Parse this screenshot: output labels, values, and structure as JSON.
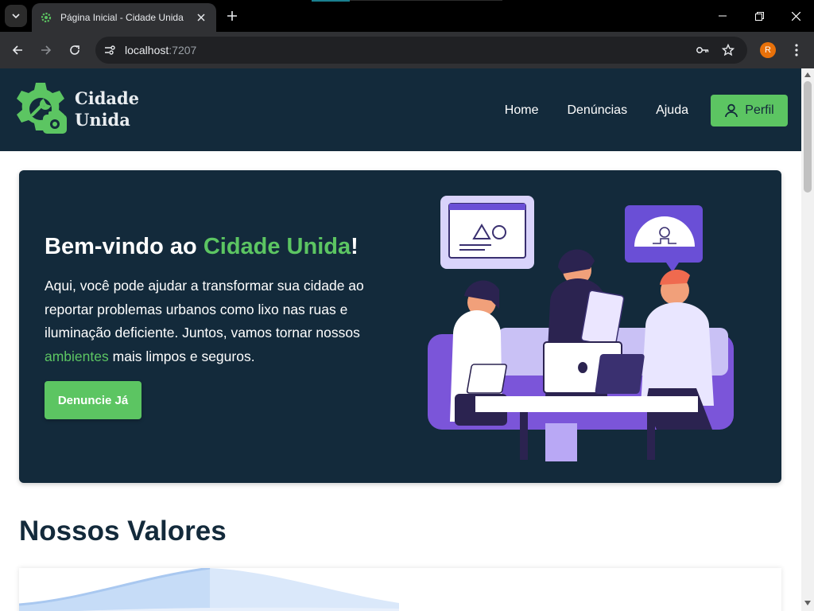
{
  "browser": {
    "tab_title": "Página Inicial - Cidade Unida",
    "url_host": "localhost",
    "url_port": ":7207",
    "profile_initial": "R",
    "profile_color": "#e8710a"
  },
  "site": {
    "logo_line1": "Cidade",
    "logo_line2": "Unida",
    "nav": [
      {
        "label": "Home"
      },
      {
        "label": "Denúncias"
      },
      {
        "label": "Ajuda"
      }
    ],
    "profile_button": "Perfil",
    "colors": {
      "navy": "#132a3b",
      "green": "#5cc562"
    }
  },
  "hero": {
    "title_prefix": "Bem-vindo ao ",
    "title_highlight": "Cidade Unida",
    "title_suffix": "!",
    "text_part1": "Aqui, você pode ajudar a transformar sua cidade ao reportar problemas urbanos como lixo nas ruas e iluminação deficiente. Juntos, vamos tornar nossos ",
    "text_highlight": "ambientes",
    "text_part2": " mais limpos e seguros.",
    "cta": "Denuncie Já"
  },
  "values": {
    "title": "Nossos Valores"
  }
}
